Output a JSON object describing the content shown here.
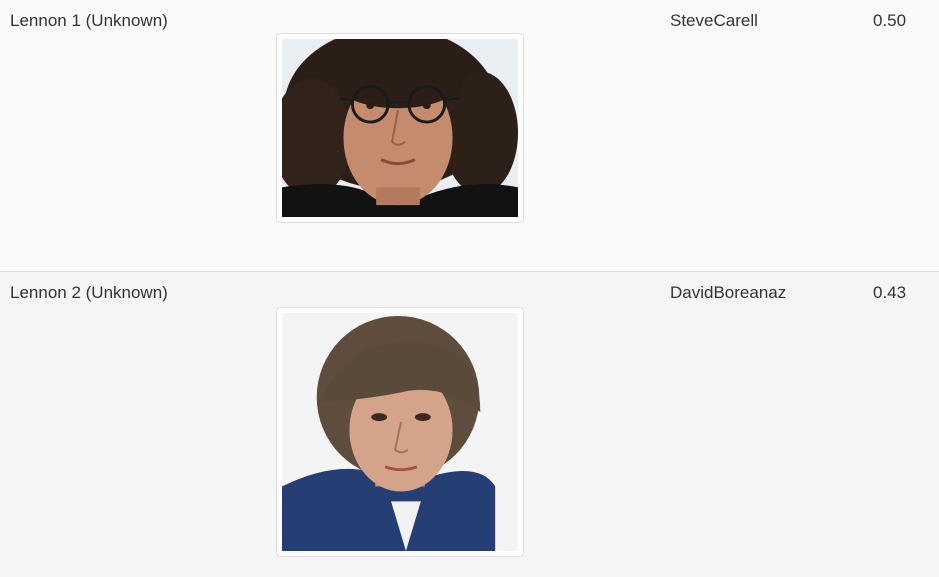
{
  "results": [
    {
      "name": "Lennon 1 (Unknown)",
      "match": "SteveCarell",
      "score": "0.50",
      "photo_icon": "portrait-photo"
    },
    {
      "name": "Lennon 2 (Unknown)",
      "match": "DavidBoreanaz",
      "score": "0.43",
      "photo_icon": "portrait-photo"
    }
  ],
  "colors": {
    "row_odd": "#f9f9f9",
    "row_even": "#f5f5f5",
    "text": "#333333",
    "border": "#dddddd"
  }
}
